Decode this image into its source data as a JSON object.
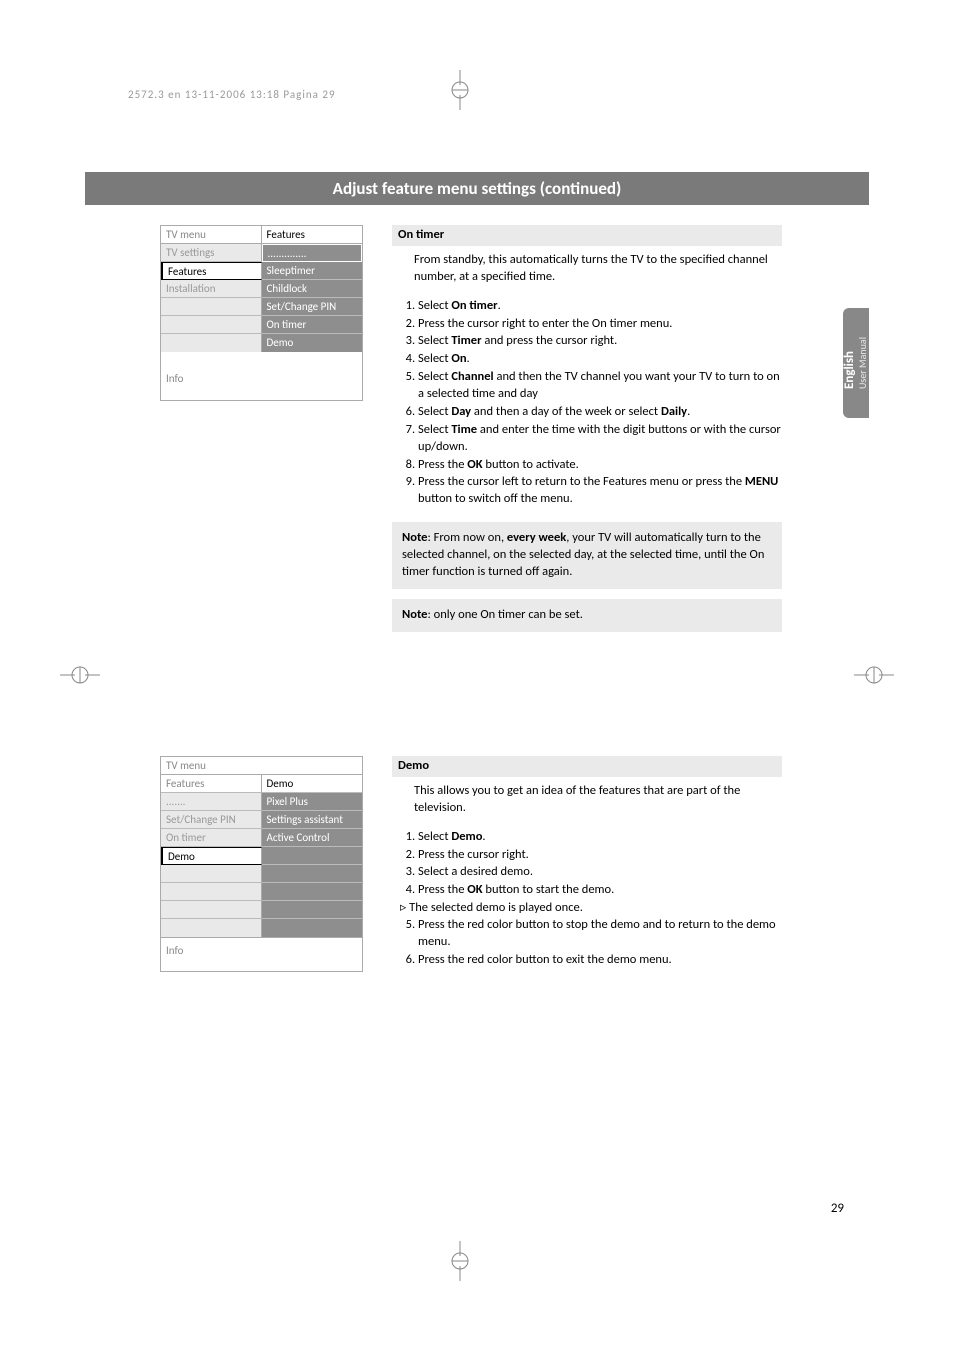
{
  "print_header": "2572.3 en  13-11-2006  13:18  Pagina 29",
  "title_bar": "Adjust feature menu settings  (continued)",
  "side_tab": {
    "lang": "English",
    "sub": "User Manual"
  },
  "menu1": {
    "title": "TV menu",
    "right_header": "Features",
    "left": [
      "TV settings",
      "Features",
      "Installation",
      "",
      "",
      ""
    ],
    "right": [
      "..............",
      "Sleeptimer",
      "Childlock",
      "Set/Change PIN",
      "On timer",
      "Demo"
    ],
    "left_sel_index": 1,
    "right_highlight_index": 0,
    "info": "Info"
  },
  "menu2": {
    "title": "TV menu",
    "left_header": "Features",
    "right_header": "Demo",
    "left": [
      ".......",
      "Set/Change PIN",
      "On timer",
      "Demo",
      "",
      "",
      "",
      ""
    ],
    "right": [
      "Pixel Plus",
      "Settings assistant",
      "Active Control",
      "",
      "",
      "",
      "",
      ""
    ],
    "left_sel_index": 3,
    "info": "Info"
  },
  "section_on_timer": {
    "heading": "On timer",
    "intro": "From standby, this automatically turns the TV to the specified channel number, at a specified time.",
    "steps": [
      {
        "pre": "Select ",
        "b": "On timer",
        "post": "."
      },
      {
        "pre": "Press the cursor right to enter the On timer menu."
      },
      {
        "pre": "Select ",
        "b": "Timer",
        "post": " and press the cursor right."
      },
      {
        "pre": "Select ",
        "b": "On",
        "post": "."
      },
      {
        "pre": "Select ",
        "b": "Channel",
        "post": " and then the TV channel you want your TV to turn to on a selected time and day"
      },
      {
        "pre": "Select ",
        "b": "Day",
        "post": " and then a day of the week or select ",
        "b2": "Daily",
        "post2": "."
      },
      {
        "pre": "Select ",
        "b": "Time",
        "post": " and enter the time with the digit buttons or with the cursor up/down."
      },
      {
        "pre": "Press the ",
        "b": "OK",
        "post": " button to activate."
      },
      {
        "pre": "Press the cursor left to return to the Features menu or press the ",
        "b": "MENU",
        "post": " button to switch off the menu."
      }
    ],
    "note1": {
      "label": "Note",
      "pre": ": From now on, ",
      "b": "every week",
      "post": ", your TV will automatically turn to the selected channel, on the selected day, at the selected time, until the On timer function is turned off again."
    },
    "note2": {
      "label": "Note",
      "text": ": only one On timer can be set."
    }
  },
  "section_demo": {
    "heading": "Demo",
    "intro": "This allows you to get an idea of the features that are part of the television.",
    "steps": [
      {
        "pre": "Select ",
        "b": "Demo",
        "post": "."
      },
      {
        "pre": "Press the cursor right."
      },
      {
        "pre": "Select a desired demo."
      },
      {
        "pre": "Press the ",
        "b": "OK",
        "post": " button to start the demo."
      }
    ],
    "tri": "The selected demo is played once.",
    "steps2": [
      {
        "pre": "Press the red color button to stop the demo and to return to the demo menu."
      },
      {
        "pre": "Press the red color button to exit the demo menu."
      }
    ]
  },
  "page_number": "29"
}
